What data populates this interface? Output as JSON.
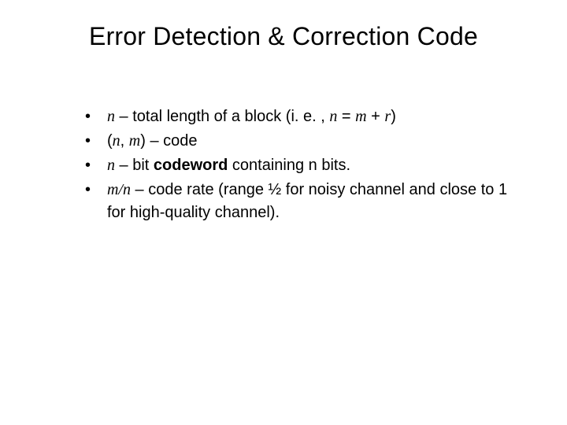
{
  "title": "Error Detection & Correction Code",
  "bullets": {
    "b1": {
      "v1": "n",
      "t1": " – total length of a block (i. e. , ",
      "v2": "n",
      "t2": " = ",
      "v3": "m",
      "t3": " + ",
      "v4": "r",
      "t4": ")"
    },
    "b2": {
      "t1": "(",
      "v1": "n",
      "t2": ", ",
      "v2": "m",
      "t3": ") – code"
    },
    "b3": {
      "v1": "n",
      "t1": " – bit ",
      "bold": "codeword",
      "t2": " containing n bits."
    },
    "b4": {
      "v1": "m/n",
      "t1": " – code rate (range ½ for noisy channel and close to 1 for high-quality channel)."
    }
  },
  "dot": "•"
}
